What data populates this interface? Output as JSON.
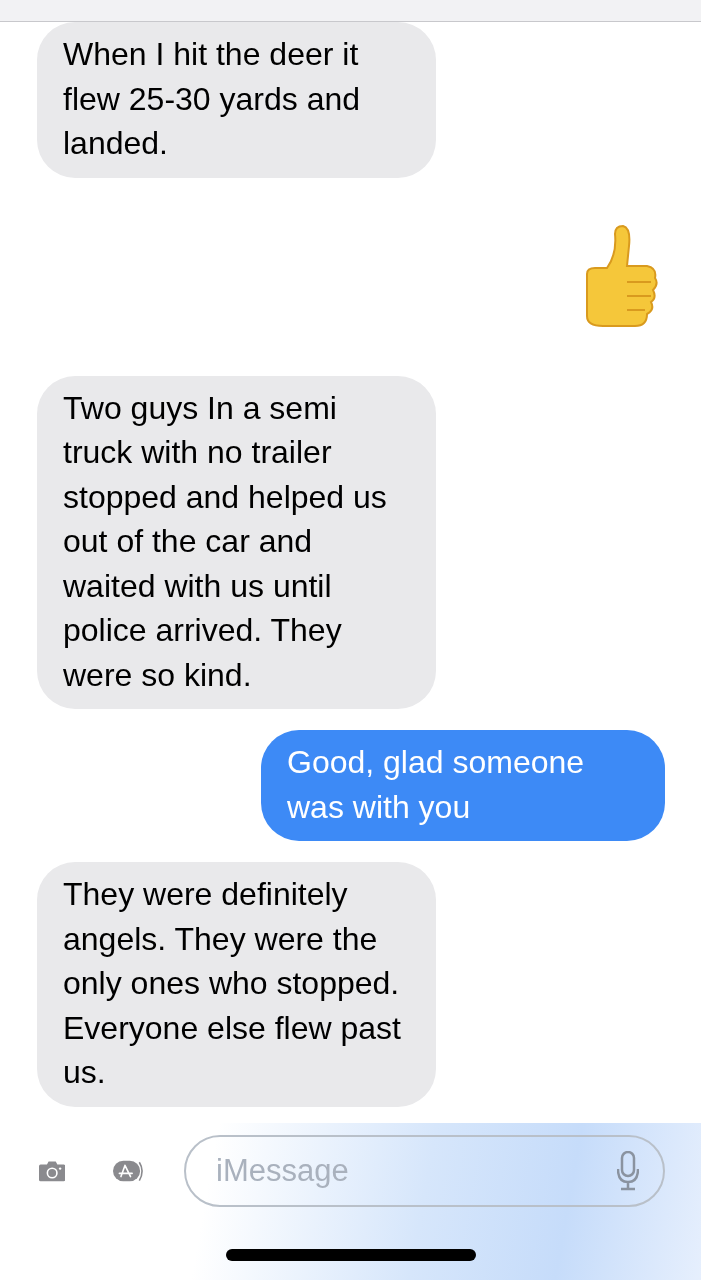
{
  "messages": [
    {
      "kind": "incoming",
      "text": "When I hit the deer it flew 25-30 yards and landed."
    },
    {
      "kind": "emoji"
    },
    {
      "kind": "incoming",
      "text": "Two guys In a semi truck with no trailer stopped and helped us out of the car and waited with us until police arrived. They were so kind."
    },
    {
      "kind": "outgoing",
      "text": "Good, glad someone was with you"
    },
    {
      "kind": "incoming",
      "text": "They were definitely angels. They were the only ones who stopped. Everyone else flew past us."
    }
  ],
  "composer": {
    "placeholder": "iMessage"
  }
}
